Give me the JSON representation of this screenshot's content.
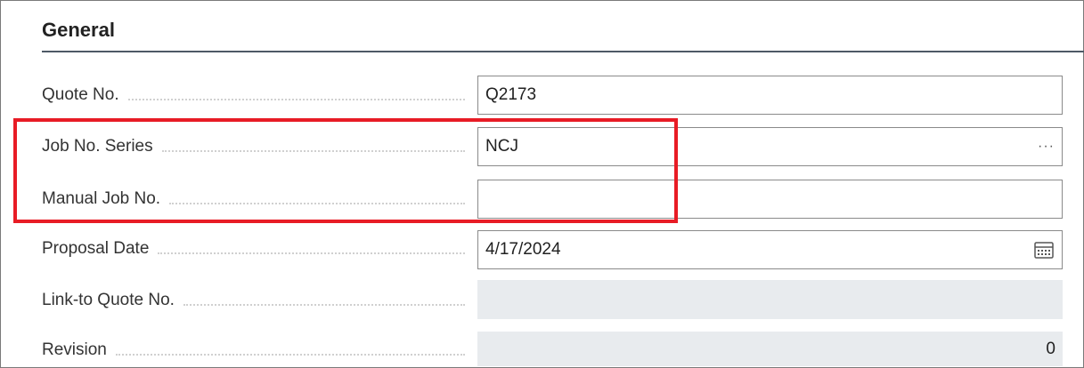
{
  "section": {
    "title": "General"
  },
  "fields": [
    {
      "label": "Quote No.",
      "value": "Q2173"
    },
    {
      "label": "Job No. Series",
      "value": "NCJ",
      "assist_icon": "ellipsis-icon",
      "assist_glyph": "···"
    },
    {
      "label": "Manual Job No.",
      "value": ""
    },
    {
      "label": "Proposal Date",
      "value": "4/17/2024",
      "assist_icon": "calendar-icon"
    },
    {
      "label": "Link-to Quote No.",
      "value": ""
    },
    {
      "label": "Revision",
      "value": "0"
    }
  ],
  "colors": {
    "highlight_border": "#e81c25",
    "readonly_field_bg": "#e8ebee",
    "field_border": "#8a8a8a",
    "section_rule": "#4e5966"
  }
}
